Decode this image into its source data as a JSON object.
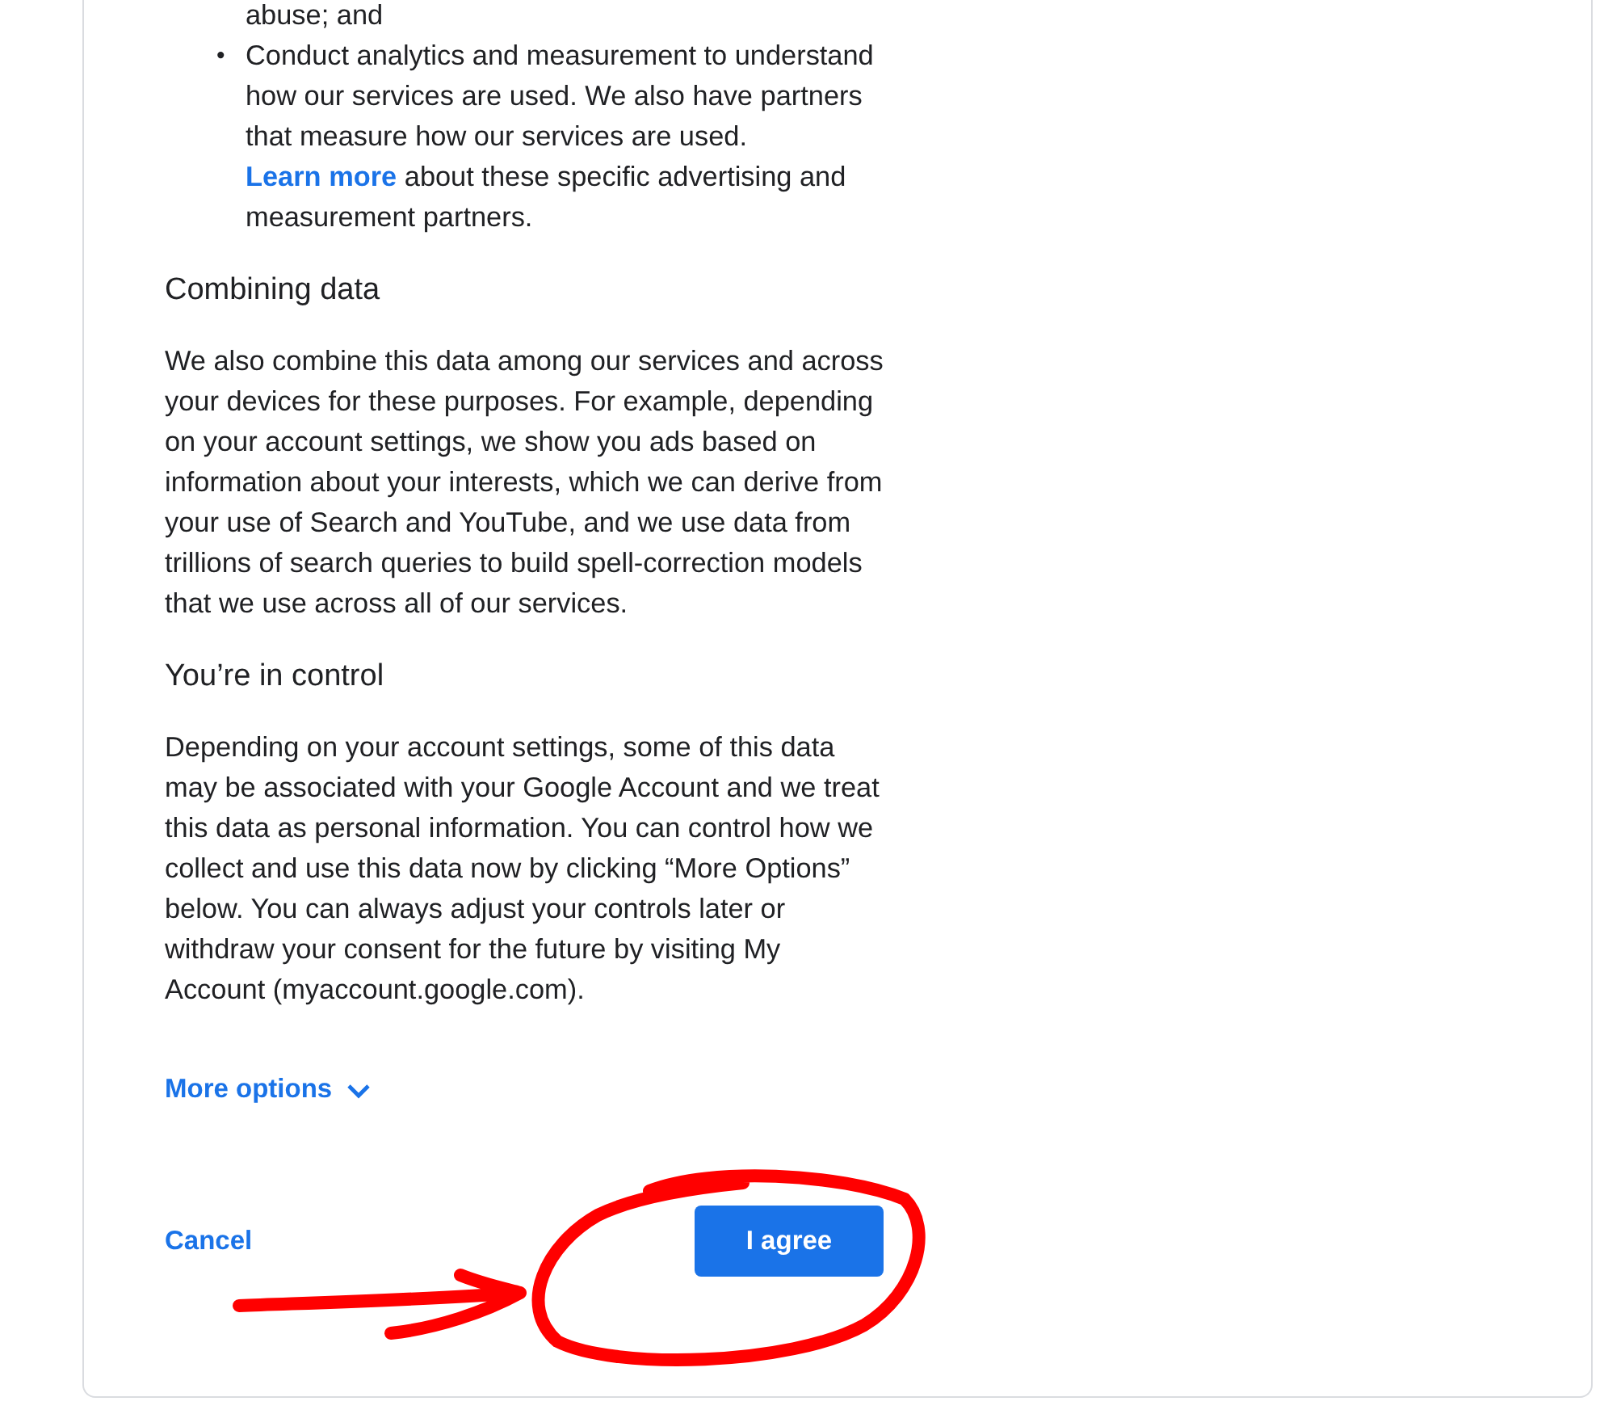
{
  "list": {
    "continued_text": "abuse; and",
    "items": [
      {
        "marker": "•",
        "before": "Conduct analytics and measurement to understand how our services are used. We also have partners that measure how our services are used. ",
        "link": "Learn more",
        "after": " about these specific advertising and measurement partners."
      }
    ]
  },
  "sections": [
    {
      "heading": "Combining data",
      "body": "We also combine this data among our services and across your devices for these purposes. For example, depending on your account settings, we show you ads based on information about your interests, which we can derive from your use of Search and YouTube, and we use data from trillions of search queries to build spell-correction models that we use across all of our services."
    },
    {
      "heading": "You’re in control",
      "body": "Depending on your account settings, some of this data may be associated with your Google Account and we treat this data as personal information. You can control how we collect and use this data now by clicking “More Options” below. You can always adjust your controls later or withdraw your consent for the future by visiting My Account (myaccount.google.com)."
    }
  ],
  "more_options": {
    "label": "More options",
    "expanded": false
  },
  "actions": {
    "cancel": "Cancel",
    "agree": "I agree"
  }
}
